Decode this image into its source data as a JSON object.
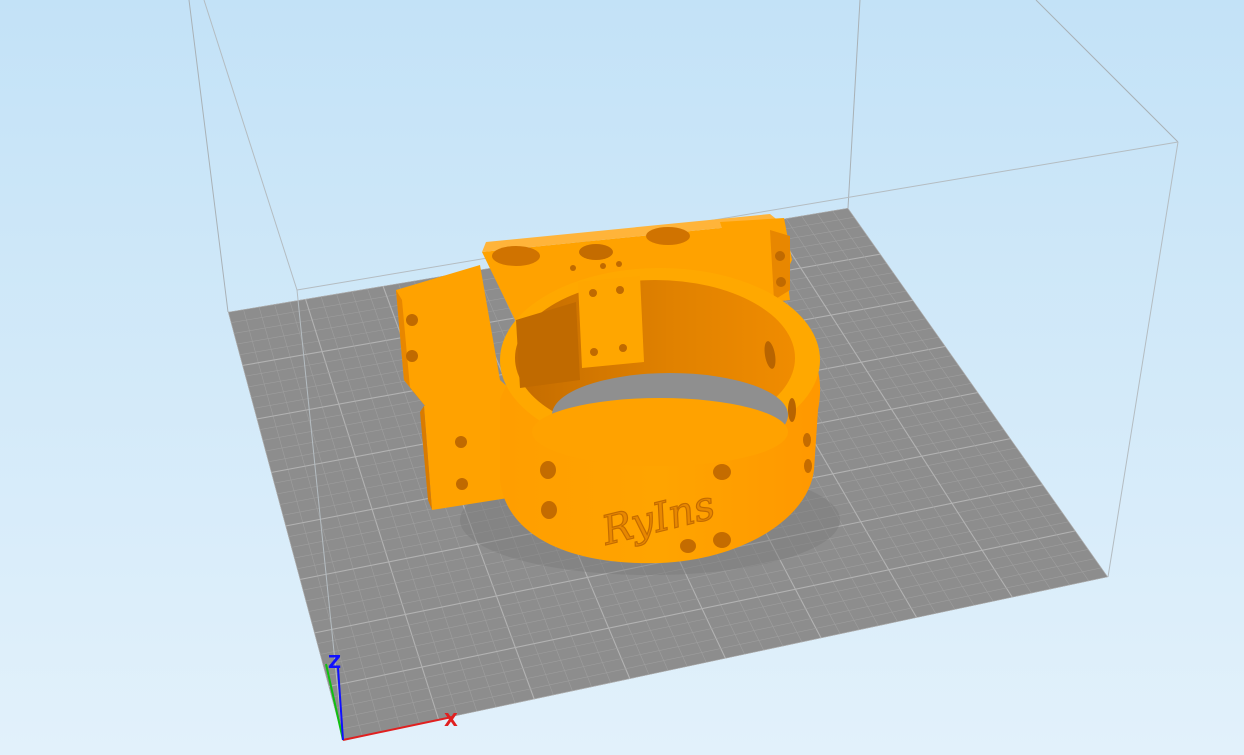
{
  "viewport": {
    "view": "3d-perspective",
    "background": {
      "top": "#c3e2f7",
      "bottom": "#e1f0fb"
    },
    "build_volume_edge_color": "#a9b1b6",
    "bed": {
      "fill": "#8d8d8d",
      "grid_color": "#9e9e9e",
      "major_grid_color": "#b2b2b2"
    },
    "model": {
      "color": "#ffa200",
      "shade_color": "#cc7200",
      "engraved_text": "RyIns"
    },
    "axes": {
      "x": {
        "label": "X",
        "color": "#e02020"
      },
      "y": {
        "label": "",
        "color": "#10c010"
      },
      "z": {
        "label": "Z",
        "color": "#1010ff"
      }
    }
  }
}
